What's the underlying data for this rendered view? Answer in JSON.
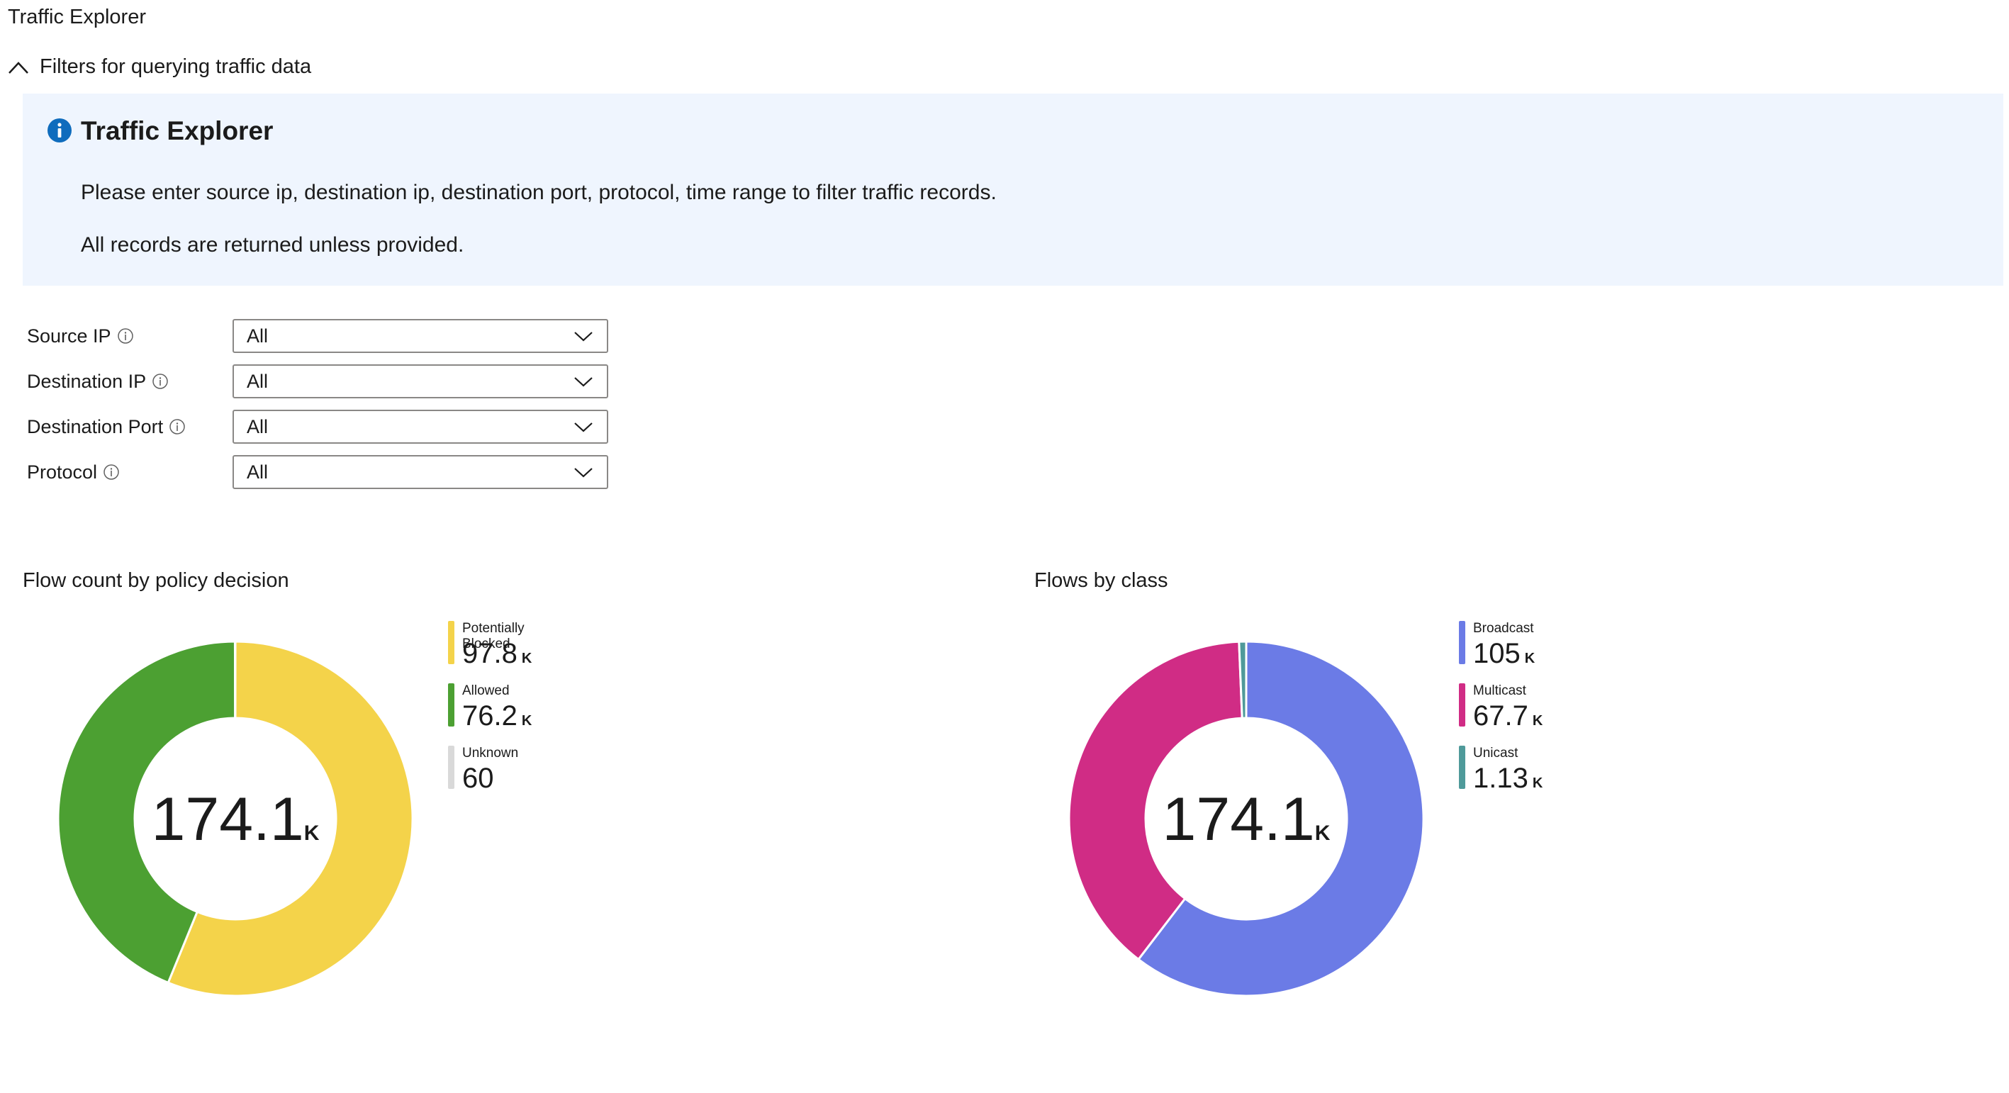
{
  "page": {
    "title": "Traffic Explorer"
  },
  "filters_section": {
    "label": "Filters for querying traffic data",
    "expanded": true
  },
  "info": {
    "title": "Traffic Explorer",
    "line1": "Please enter source ip, destination ip, destination port, protocol, time range to filter traffic records.",
    "line2": "All records are returned unless provided.",
    "icon": "info-icon",
    "accent": "#0f6cbd"
  },
  "filters": [
    {
      "label": "Source IP",
      "value": "All"
    },
    {
      "label": "Destination IP",
      "value": "All"
    },
    {
      "label": "Destination Port",
      "value": "All"
    },
    {
      "label": "Protocol",
      "value": "All"
    }
  ],
  "chart_data": [
    {
      "type": "pie",
      "title": "Flow count by policy decision",
      "center_value": "174.1",
      "center_unit": "K",
      "series": [
        {
          "name": "Potentially Blocked",
          "value": 97800,
          "display": "97.8",
          "unit": "K",
          "color": "#f4d34a"
        },
        {
          "name": "Allowed",
          "value": 76200,
          "display": "76.2",
          "unit": "K",
          "color": "#4ca032"
        },
        {
          "name": "Unknown",
          "value": 60,
          "display": "60",
          "unit": "",
          "color": "#d9d9d9"
        }
      ]
    },
    {
      "type": "pie",
      "title": "Flows by class",
      "center_value": "174.1",
      "center_unit": "K",
      "series": [
        {
          "name": "Broadcast",
          "value": 105000,
          "display": "105",
          "unit": "K",
          "color": "#6b7be6"
        },
        {
          "name": "Multicast",
          "value": 67700,
          "display": "67.7",
          "unit": "K",
          "color": "#d02c85"
        },
        {
          "name": "Unicast",
          "value": 1130,
          "display": "1.13",
          "unit": "K",
          "color": "#4f9a9a"
        }
      ]
    }
  ]
}
